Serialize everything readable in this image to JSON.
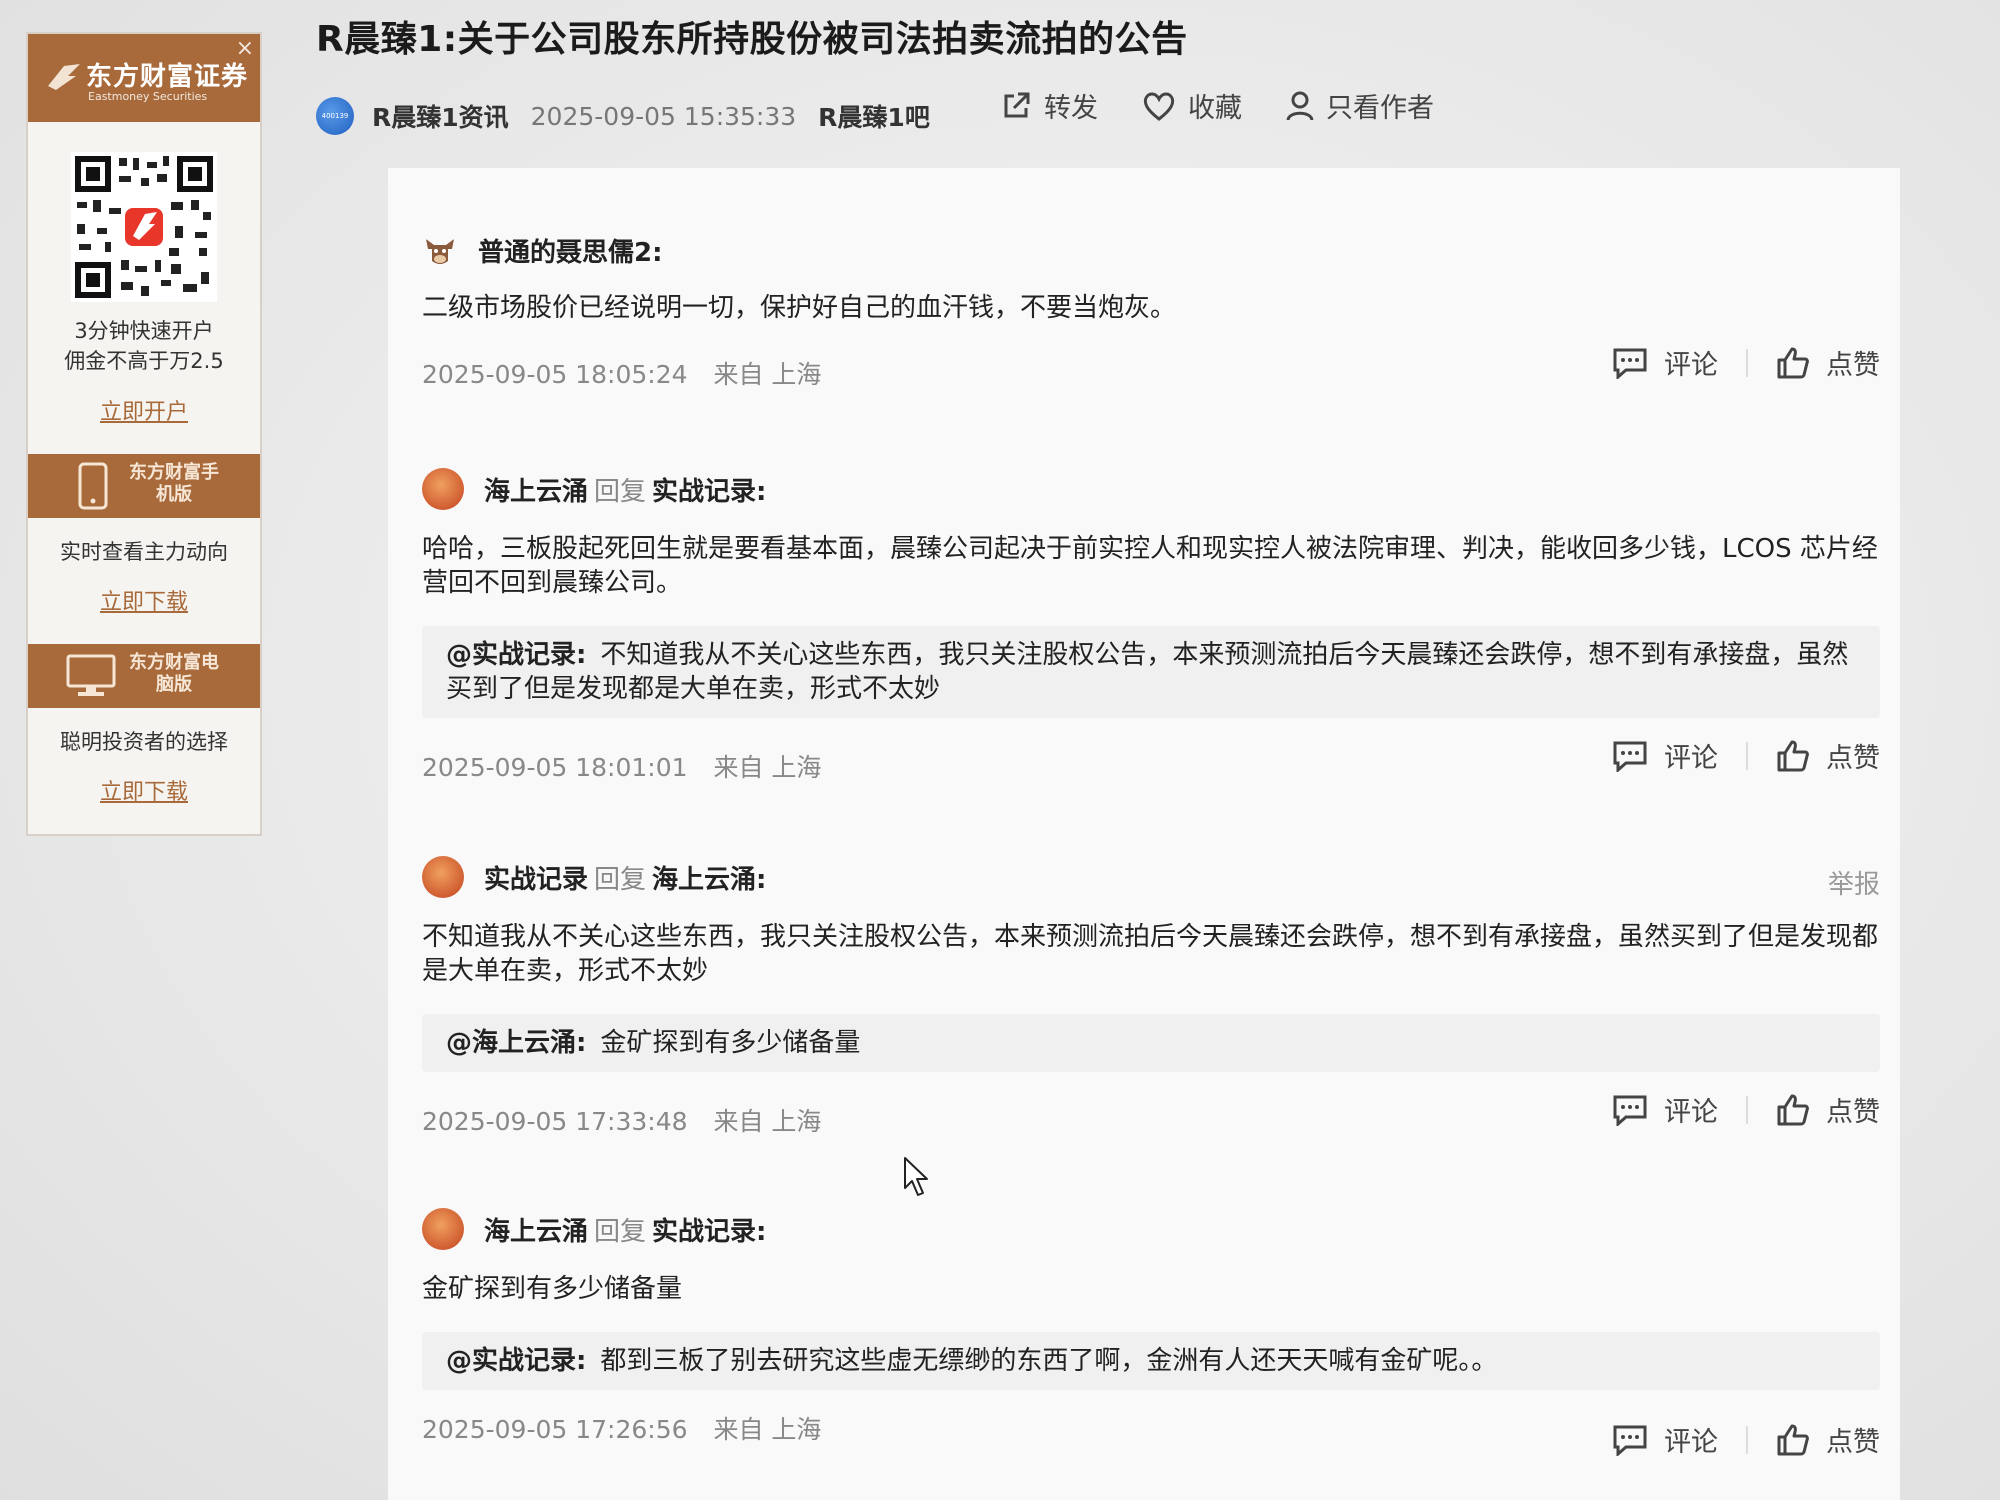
{
  "sidebar": {
    "brand_name": "东方财富证券",
    "brand_en": "Eastmoney Securities",
    "close_label": "×",
    "qr_line1": "3分钟快速开户",
    "qr_line2": "佣金不高于万2.5",
    "open_link": "立即开户",
    "mobile_label": "东方财富手机版",
    "mobile_desc": "实时查看主力动向",
    "mobile_link": "立即下载",
    "pc_label": "东方财富电脑版",
    "pc_desc": "聪明投资者的选择",
    "pc_link": "立即下载",
    "accent": "#a86a3a"
  },
  "post": {
    "title": "R晨臻1:关于公司股东所持股份被司法拍卖流拍的公告",
    "author": "R晨臻1资讯",
    "author_avatar_text": "400139",
    "time": "2025-09-05 15:35:33",
    "bar": "R晨臻1吧",
    "actions": {
      "share": "转发",
      "favorite": "收藏",
      "author_only": "只看作者"
    }
  },
  "comments": [
    {
      "name": "普通的聂思儒2:",
      "reply_label": "",
      "target": "",
      "body": "二级市场股价已经说明一切，保护好自己的血汗钱，不要当炮灰。",
      "quote_name": "",
      "quote_text": "",
      "time": "2025-09-05 18:05:24",
      "location": "来自 上海",
      "report": "",
      "comment_label": "评论",
      "like_label": "点赞"
    },
    {
      "name": "海上云涌",
      "reply_label": "回复",
      "target": "实战记录:",
      "body": "哈哈，三板股起死回生就是要看基本面，晨臻公司起决于前实控人和现实控人被法院审理、判决，能收回多少钱，LCOS 芯片经营回不回到晨臻公司。",
      "quote_name": "@实战记录:",
      "quote_text": "不知道我从不关心这些东西，我只关注股权公告，本来预测流拍后今天晨臻还会跌停，想不到有承接盘，虽然买到了但是发现都是大单在卖，形式不太妙",
      "time": "2025-09-05 18:01:01",
      "location": "来自 上海",
      "report": "",
      "comment_label": "评论",
      "like_label": "点赞"
    },
    {
      "name": "实战记录",
      "reply_label": "回复",
      "target": "海上云涌:",
      "body": "不知道我从不关心这些东西，我只关注股权公告，本来预测流拍后今天晨臻还会跌停，想不到有承接盘，虽然买到了但是发现都是大单在卖，形式不太妙",
      "quote_name": "@海上云涌:",
      "quote_text": "金矿探到有多少储备量",
      "time": "2025-09-05 17:33:48",
      "location": "来自 上海",
      "report": "举报",
      "comment_label": "评论",
      "like_label": "点赞"
    },
    {
      "name": "海上云涌",
      "reply_label": "回复",
      "target": "实战记录:",
      "body": "金矿探到有多少储备量",
      "quote_name": "@实战记录:",
      "quote_text": "都到三板了别去研究这些虚无缥缈的东西了啊，金洲有人还天天喊有金矿呢。。",
      "time": "2025-09-05 17:26:56",
      "location": "来自 上海",
      "report": "",
      "comment_label": "评论",
      "like_label": "点赞"
    }
  ]
}
